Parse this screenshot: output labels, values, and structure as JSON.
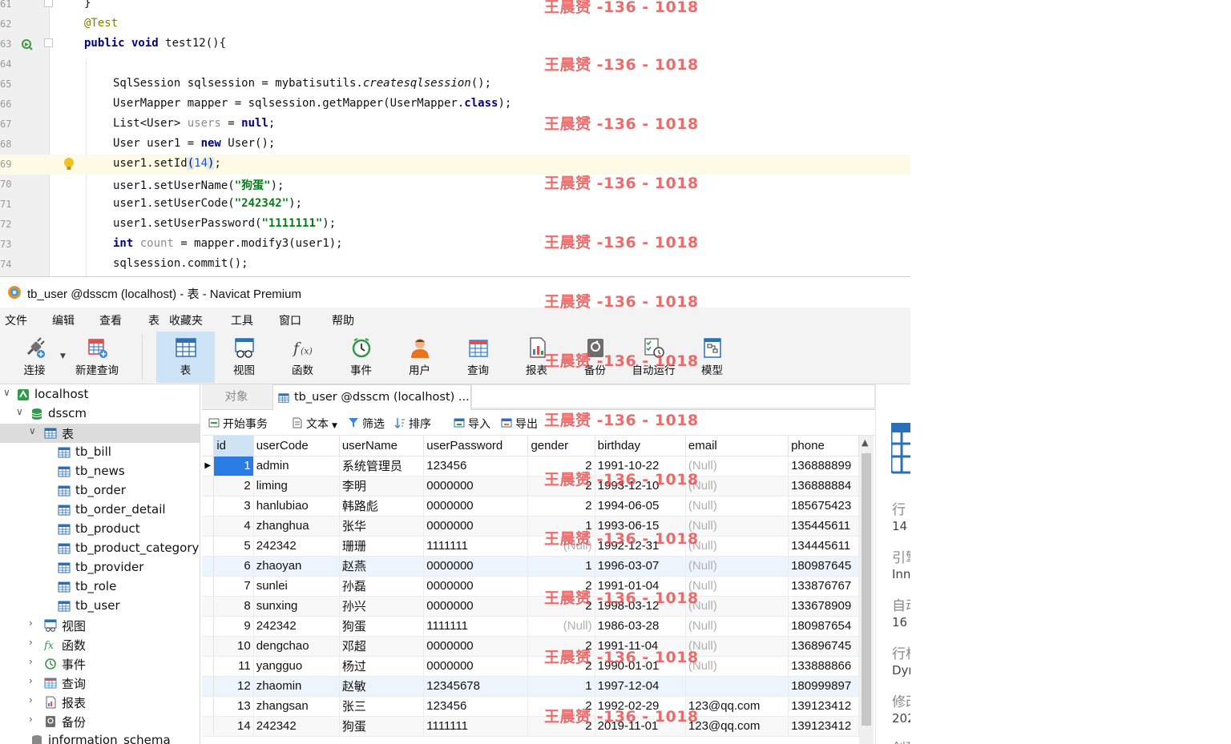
{
  "editor": {
    "lines": [
      {
        "n": "61",
        "text": "}"
      },
      {
        "n": "62",
        "text": "@Test"
      },
      {
        "n": "63",
        "text": "public void test12(){"
      },
      {
        "n": "64",
        "text": ""
      },
      {
        "n": "65",
        "text": "SqlSession sqlsession = mybatisutils.createsqlsession();"
      },
      {
        "n": "66",
        "text": "UserMapper mapper = sqlsession.getMapper(UserMapper.class);"
      },
      {
        "n": "67",
        "text": "List<User> users = null;"
      },
      {
        "n": "68",
        "text": "User user1 = new User();"
      },
      {
        "n": "69",
        "text": "user1.setId(14);"
      },
      {
        "n": "70",
        "text": "user1.setUserName(\"狗蛋\");"
      },
      {
        "n": "71",
        "text": "user1.setUserCode(\"242342\");"
      },
      {
        "n": "72",
        "text": "user1.setUserPassword(\"1111111\");"
      },
      {
        "n": "73",
        "text": "int count = mapper.modify3(user1);"
      },
      {
        "n": "74",
        "text": "sqlsession.commit();"
      }
    ]
  },
  "window_title": "tb_user @dsscm (localhost) - 表 - Navicat Premium",
  "menu": [
    "文件",
    "编辑",
    "查看",
    "表",
    "收藏夹",
    "工具",
    "窗口",
    "帮助"
  ],
  "toolbar": [
    "连接",
    "新建查询",
    "表",
    "视图",
    "函数",
    "事件",
    "用户",
    "查询",
    "报表",
    "备份",
    "自动运行",
    "模型"
  ],
  "sidebar": {
    "connection": "localhost",
    "database": "dsscm",
    "tables_node": "表",
    "tables": [
      "tb_bill",
      "tb_news",
      "tb_order",
      "tb_order_detail",
      "tb_product",
      "tb_product_category",
      "tb_provider",
      "tb_role",
      "tb_user"
    ],
    "other_nodes": [
      "视图",
      "函数",
      "事件",
      "查询",
      "报表",
      "备份"
    ],
    "next_database": "information_schema"
  },
  "tabs": {
    "objects": "对象",
    "active": "tb_user @dsscm (localhost) ..."
  },
  "subtoolbar": {
    "begin_tx": "开始事务",
    "text": "文本",
    "filter": "筛选",
    "sort": "排序",
    "import": "导入",
    "export": "导出"
  },
  "grid": {
    "columns": [
      "id",
      "userCode",
      "userName",
      "userPassword",
      "gender",
      "birthday",
      "email",
      "phone"
    ],
    "rows": [
      [
        "1",
        "admin",
        "系统管理员",
        "123456",
        "2",
        "1991-10-22",
        "(Null)",
        "136888899"
      ],
      [
        "2",
        "liming",
        "李明",
        "0000000",
        "2",
        "1993-12-10",
        "(Null)",
        "136888884"
      ],
      [
        "3",
        "hanlubiao",
        "韩路彪",
        "0000000",
        "2",
        "1994-06-05",
        "(Null)",
        "185675423"
      ],
      [
        "4",
        "zhanghua",
        "张华",
        "0000000",
        "1",
        "1993-06-15",
        "(Null)",
        "135445611"
      ],
      [
        "5",
        "242342",
        "珊珊",
        "1111111",
        "(Null)",
        "1992-12-31",
        "(Null)",
        "134445611"
      ],
      [
        "6",
        "zhaoyan",
        "赵燕",
        "0000000",
        "1",
        "1996-03-07",
        "(Null)",
        "180987645"
      ],
      [
        "7",
        "sunlei",
        "孙磊",
        "0000000",
        "2",
        "1991-01-04",
        "(Null)",
        "133876767"
      ],
      [
        "8",
        "sunxing",
        "孙兴",
        "0000000",
        "2",
        "1998-03-12",
        "(Null)",
        "133678909"
      ],
      [
        "9",
        "242342",
        "狗蛋",
        "1111111",
        "(Null)",
        "1986-03-28",
        "(Null)",
        "180987654"
      ],
      [
        "10",
        "dengchao",
        "邓超",
        "0000000",
        "2",
        "1991-11-04",
        "(Null)",
        "136896745"
      ],
      [
        "11",
        "yangguo",
        "杨过",
        "0000000",
        "2",
        "1990-01-01",
        "(Null)",
        "133888866"
      ],
      [
        "12",
        "zhaomin",
        "赵敏",
        "12345678",
        "1",
        "1997-12-04",
        "",
        "180999897"
      ],
      [
        "13",
        "zhangsan",
        "张三",
        "123456",
        "2",
        "1992-02-29",
        "123@qq.com",
        "139123412"
      ],
      [
        "14",
        "242342",
        "狗蛋",
        "1111111",
        "2",
        "2019-11-01",
        "123@qq.com",
        "139123412"
      ]
    ]
  },
  "info_panel": [
    {
      "label": "行",
      "value": "14"
    },
    {
      "label": "引擎",
      "value": "Inn"
    },
    {
      "label": "自动",
      "value": "16"
    },
    {
      "label": "行格",
      "value": "Dyn"
    },
    {
      "label": "修改",
      "value": "202"
    },
    {
      "label": "创建",
      "value": ""
    }
  ],
  "watermark": "王晨赟 -136 - 1018"
}
